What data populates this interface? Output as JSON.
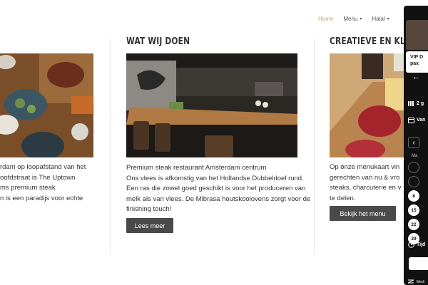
{
  "nav": {
    "items": [
      {
        "label": "Home",
        "active": true,
        "dropdown": false
      },
      {
        "label": "Menu",
        "active": false,
        "dropdown": true
      },
      {
        "label": "Halal",
        "active": false,
        "dropdown": true
      }
    ]
  },
  "columns": {
    "left": {
      "lines": [
        "rdam op loopafstand van het",
        "oofdstraat is The Uptown",
        "ms premium steak",
        "n is een paradijs voor echte"
      ]
    },
    "middle": {
      "heading": "WAT WIJ DOEN",
      "subtitle": "Premium steak restaurant Amsterdam centrum",
      "body": "Ons vlees is afkomstig van het Hollandse Dubbeldoel rund. Een ras die zowel goed geschikt is voor het produceren van melk als van vlees. De Mibrasa houtskoolovens zorgt voor de finishing touch!",
      "button": "Lees meer"
    },
    "right": {
      "heading": "CREATIEVE EN KLASSI",
      "lines": [
        "Op onze menukaart vin",
        "gerechten van nu & vro",
        "steaks, charcuterie en v",
        "te delen."
      ],
      "button": "Bekijk het menu"
    }
  },
  "widget": {
    "vip_line1": "VIP D",
    "vip_line2": "pax",
    "back_arrow": "←",
    "guests": "2 g",
    "date": "Van",
    "prev": "‹",
    "weekday": "Ma",
    "days": [
      "",
      "",
      "8",
      "15",
      "22",
      "29"
    ],
    "time_label": "Tijd",
    "footer": "Medi"
  },
  "colors": {
    "accent": "#c2a877",
    "button": "#4a4a4a",
    "widget_bg": "#111111"
  }
}
